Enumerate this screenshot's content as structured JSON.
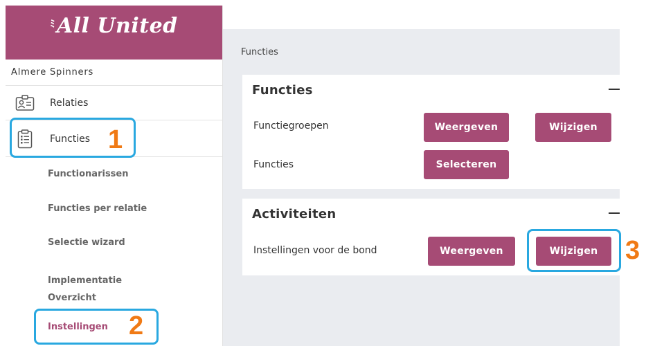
{
  "app": {
    "logo_text": "All United",
    "logo_mark": "ﾐ"
  },
  "sidebar": {
    "organization": "Almere Spinners",
    "items": [
      {
        "label": "Relaties",
        "icon": "contact-card-icon"
      },
      {
        "label": "Functies",
        "icon": "clipboard-list-icon"
      }
    ],
    "subitems": [
      {
        "label": "Functionarissen"
      },
      {
        "label": "Functies per relatie"
      },
      {
        "label": "Selectie wizard"
      },
      {
        "label": "Implementatie Overzicht"
      },
      {
        "label": "Instellingen",
        "active": true
      }
    ]
  },
  "main": {
    "breadcrumb": "Functies",
    "cards": [
      {
        "title": "Functies",
        "rows": [
          {
            "label": "Functiegroepen",
            "buttons": [
              "Weergeven",
              "Wijzigen"
            ]
          },
          {
            "label": "Functies",
            "buttons": [
              "Selecteren"
            ]
          }
        ]
      },
      {
        "title": "Activiteiten",
        "rows": [
          {
            "label": "Instellingen voor de bond",
            "buttons": [
              "Weergeven",
              "Wijzigen"
            ]
          }
        ]
      }
    ]
  },
  "annotations": {
    "step1": "1",
    "step2": "2",
    "step3": "3"
  },
  "colors": {
    "brand": "#a64b75",
    "callout_border": "#29a8e0",
    "callout_number": "#f07a15",
    "content_bg": "#eaecf0"
  }
}
